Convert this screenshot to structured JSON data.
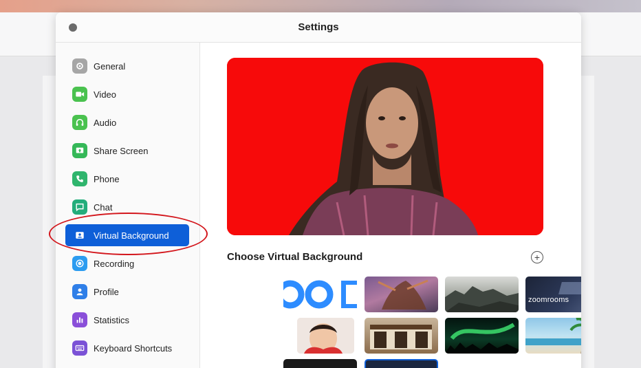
{
  "window": {
    "title": "Settings"
  },
  "sidebar": {
    "items": [
      {
        "label": "General",
        "icon": "gear-icon",
        "color": "#9a9a9a"
      },
      {
        "label": "Video",
        "icon": "video-icon",
        "color": "#4ac24f"
      },
      {
        "label": "Audio",
        "icon": "headphones-icon",
        "color": "#4ac24f"
      },
      {
        "label": "Share Screen",
        "icon": "share-screen-icon",
        "color": "#35b858"
      },
      {
        "label": "Phone",
        "icon": "phone-icon",
        "color": "#2fb56d"
      },
      {
        "label": "Chat",
        "icon": "chat-icon",
        "color": "#23ad7b"
      },
      {
        "label": "Virtual Background",
        "icon": "portrait-icon",
        "color": "#ffffff",
        "active": true
      },
      {
        "label": "Recording",
        "icon": "recording-icon",
        "color": "#2c9cf0"
      },
      {
        "label": "Profile",
        "icon": "profile-icon",
        "color": "#2f7fe8"
      },
      {
        "label": "Statistics",
        "icon": "statistics-icon",
        "color": "#8a4fd9"
      },
      {
        "label": "Keyboard Shortcuts",
        "icon": "keyboard-icon",
        "color": "#7b52d6"
      }
    ]
  },
  "main": {
    "section_title": "Choose Virtual Background",
    "add_label": "+",
    "preview_color": "#f70a0a",
    "thumbnails": [
      {
        "name": "zoom-logo"
      },
      {
        "name": "fantasy-creature"
      },
      {
        "name": "rocky-coast"
      },
      {
        "name": "zoom-rooms",
        "text": "zoomrooms"
      },
      {
        "name": "child-portrait"
      },
      {
        "name": "store-front"
      },
      {
        "name": "aurora"
      },
      {
        "name": "beach-palm"
      }
    ]
  },
  "colors": {
    "accent": "#0e5fd8",
    "annotation": "#d3161c"
  }
}
